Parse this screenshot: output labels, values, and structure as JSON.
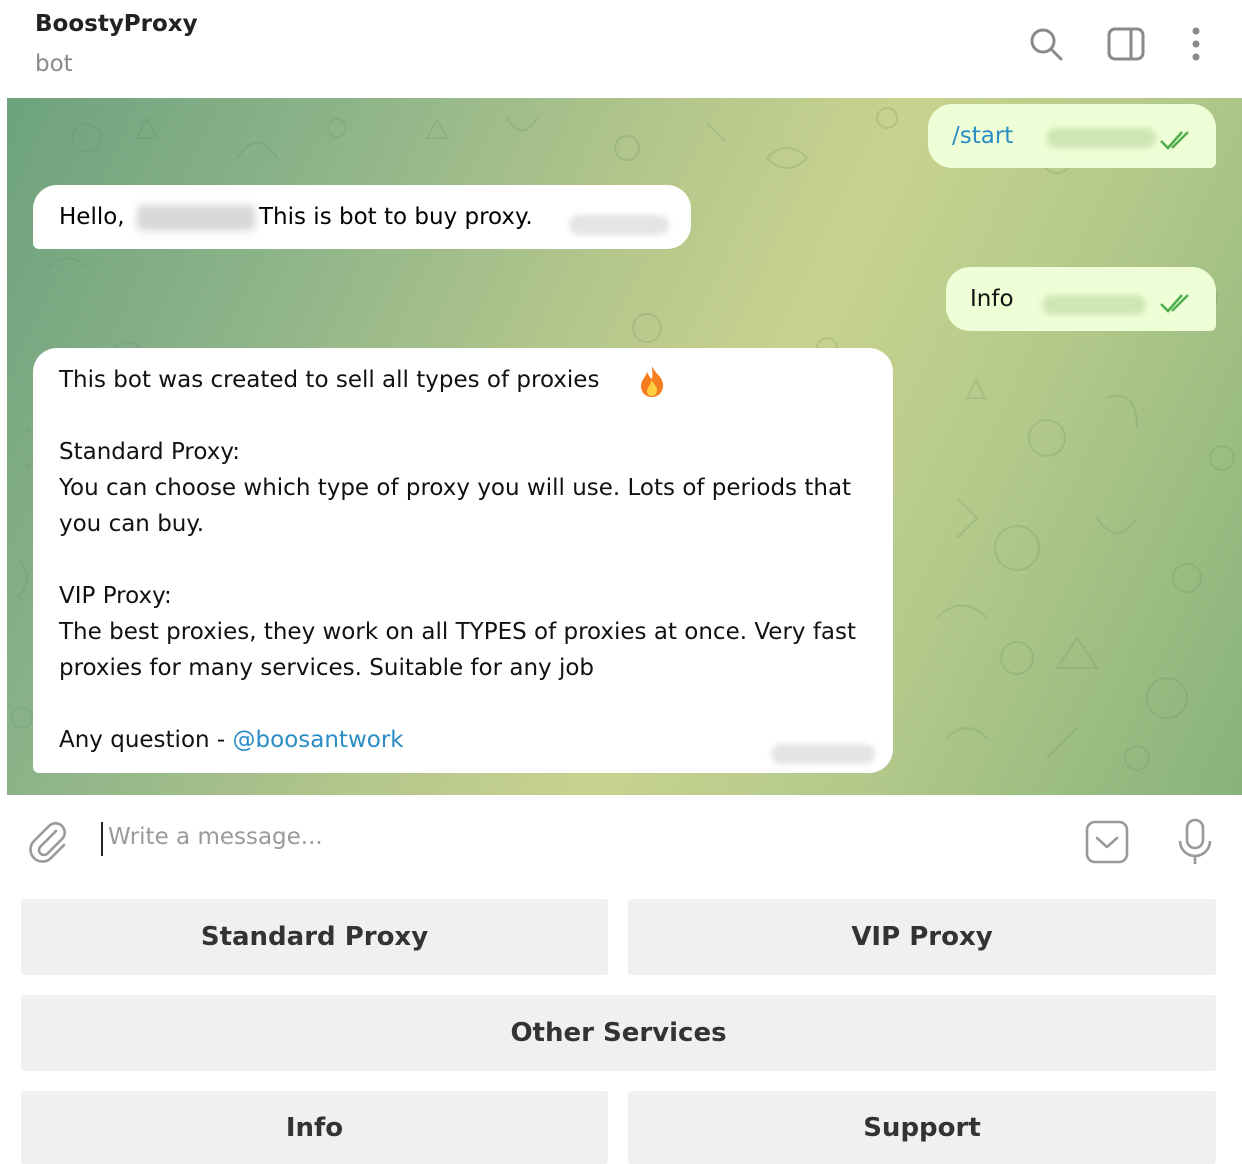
{
  "header": {
    "title": "BoostyProxy",
    "subtitle": "bot"
  },
  "messages": {
    "start": "/start",
    "hello_prefix": "Hello,",
    "hello_suffix": "This is bot to buy proxy.",
    "info_out": "Info",
    "long": "This bot was created to sell all types of proxies\n\nStandard Proxy:\nYou can choose which type of proxy you will use. Lots of periods that you can buy.\n\nVIP Proxy:\nThe best proxies, they work on all TYPES of proxies at once. Very fast proxies for many services. Suitable for any job\n\nAny question - ",
    "mention": "@boosantwork"
  },
  "input": {
    "placeholder": "Write a message..."
  },
  "keyboard": {
    "standard": "Standard Proxy",
    "vip": "VIP Proxy",
    "other": "Other Services",
    "info": "Info",
    "support": "Support"
  },
  "icons": [
    "search-icon",
    "sidebar-icon",
    "more-vertical-icon",
    "attach-icon",
    "keyboard-toggle-icon",
    "microphone-icon",
    "fire-icon",
    "double-check-icon"
  ],
  "colors": {
    "link": "#2a8dc5",
    "outgoing_bubble": "#eefed7",
    "check": "#4fae4e"
  }
}
